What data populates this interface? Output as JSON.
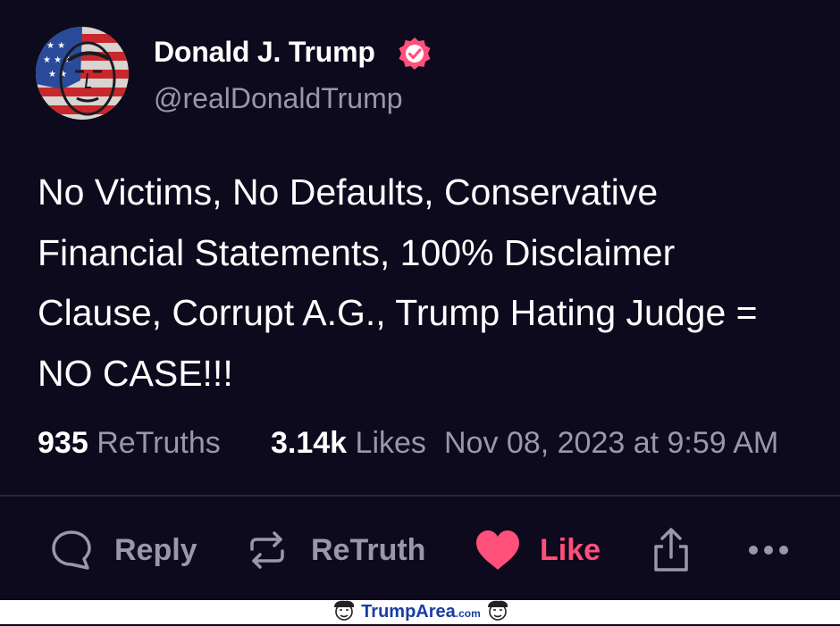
{
  "post": {
    "display_name": "Donald J. Trump",
    "handle": "@realDonaldTrump",
    "text": "No Victims, No Defaults, Conservative Financial Statements, 100% Disclaimer Clause, Corrupt A.G., Trump Hating Judge = NO CASE!!!",
    "retruths_count": "935",
    "retruths_label": "ReTruths",
    "likes_count": "3.14k",
    "likes_label": "Likes",
    "timestamp": "Nov 08, 2023 at 9:59 AM"
  },
  "actions": {
    "reply_label": "Reply",
    "retruth_label": "ReTruth",
    "like_label": "Like"
  },
  "icons": {
    "verified": "verified-badge-icon",
    "reply": "speech-bubble-icon",
    "retruth": "repost-arrows-icon",
    "like": "heart-icon",
    "share": "share-upload-icon",
    "more": "ellipsis-icon"
  },
  "colors": {
    "background": "#0c0a1c",
    "accent_like": "#ff4f7b",
    "muted_text": "#9a97a9",
    "verified_badge": "#ff4f7b"
  },
  "watermark": {
    "brand": "TrumpArea",
    "tld": ".com"
  }
}
